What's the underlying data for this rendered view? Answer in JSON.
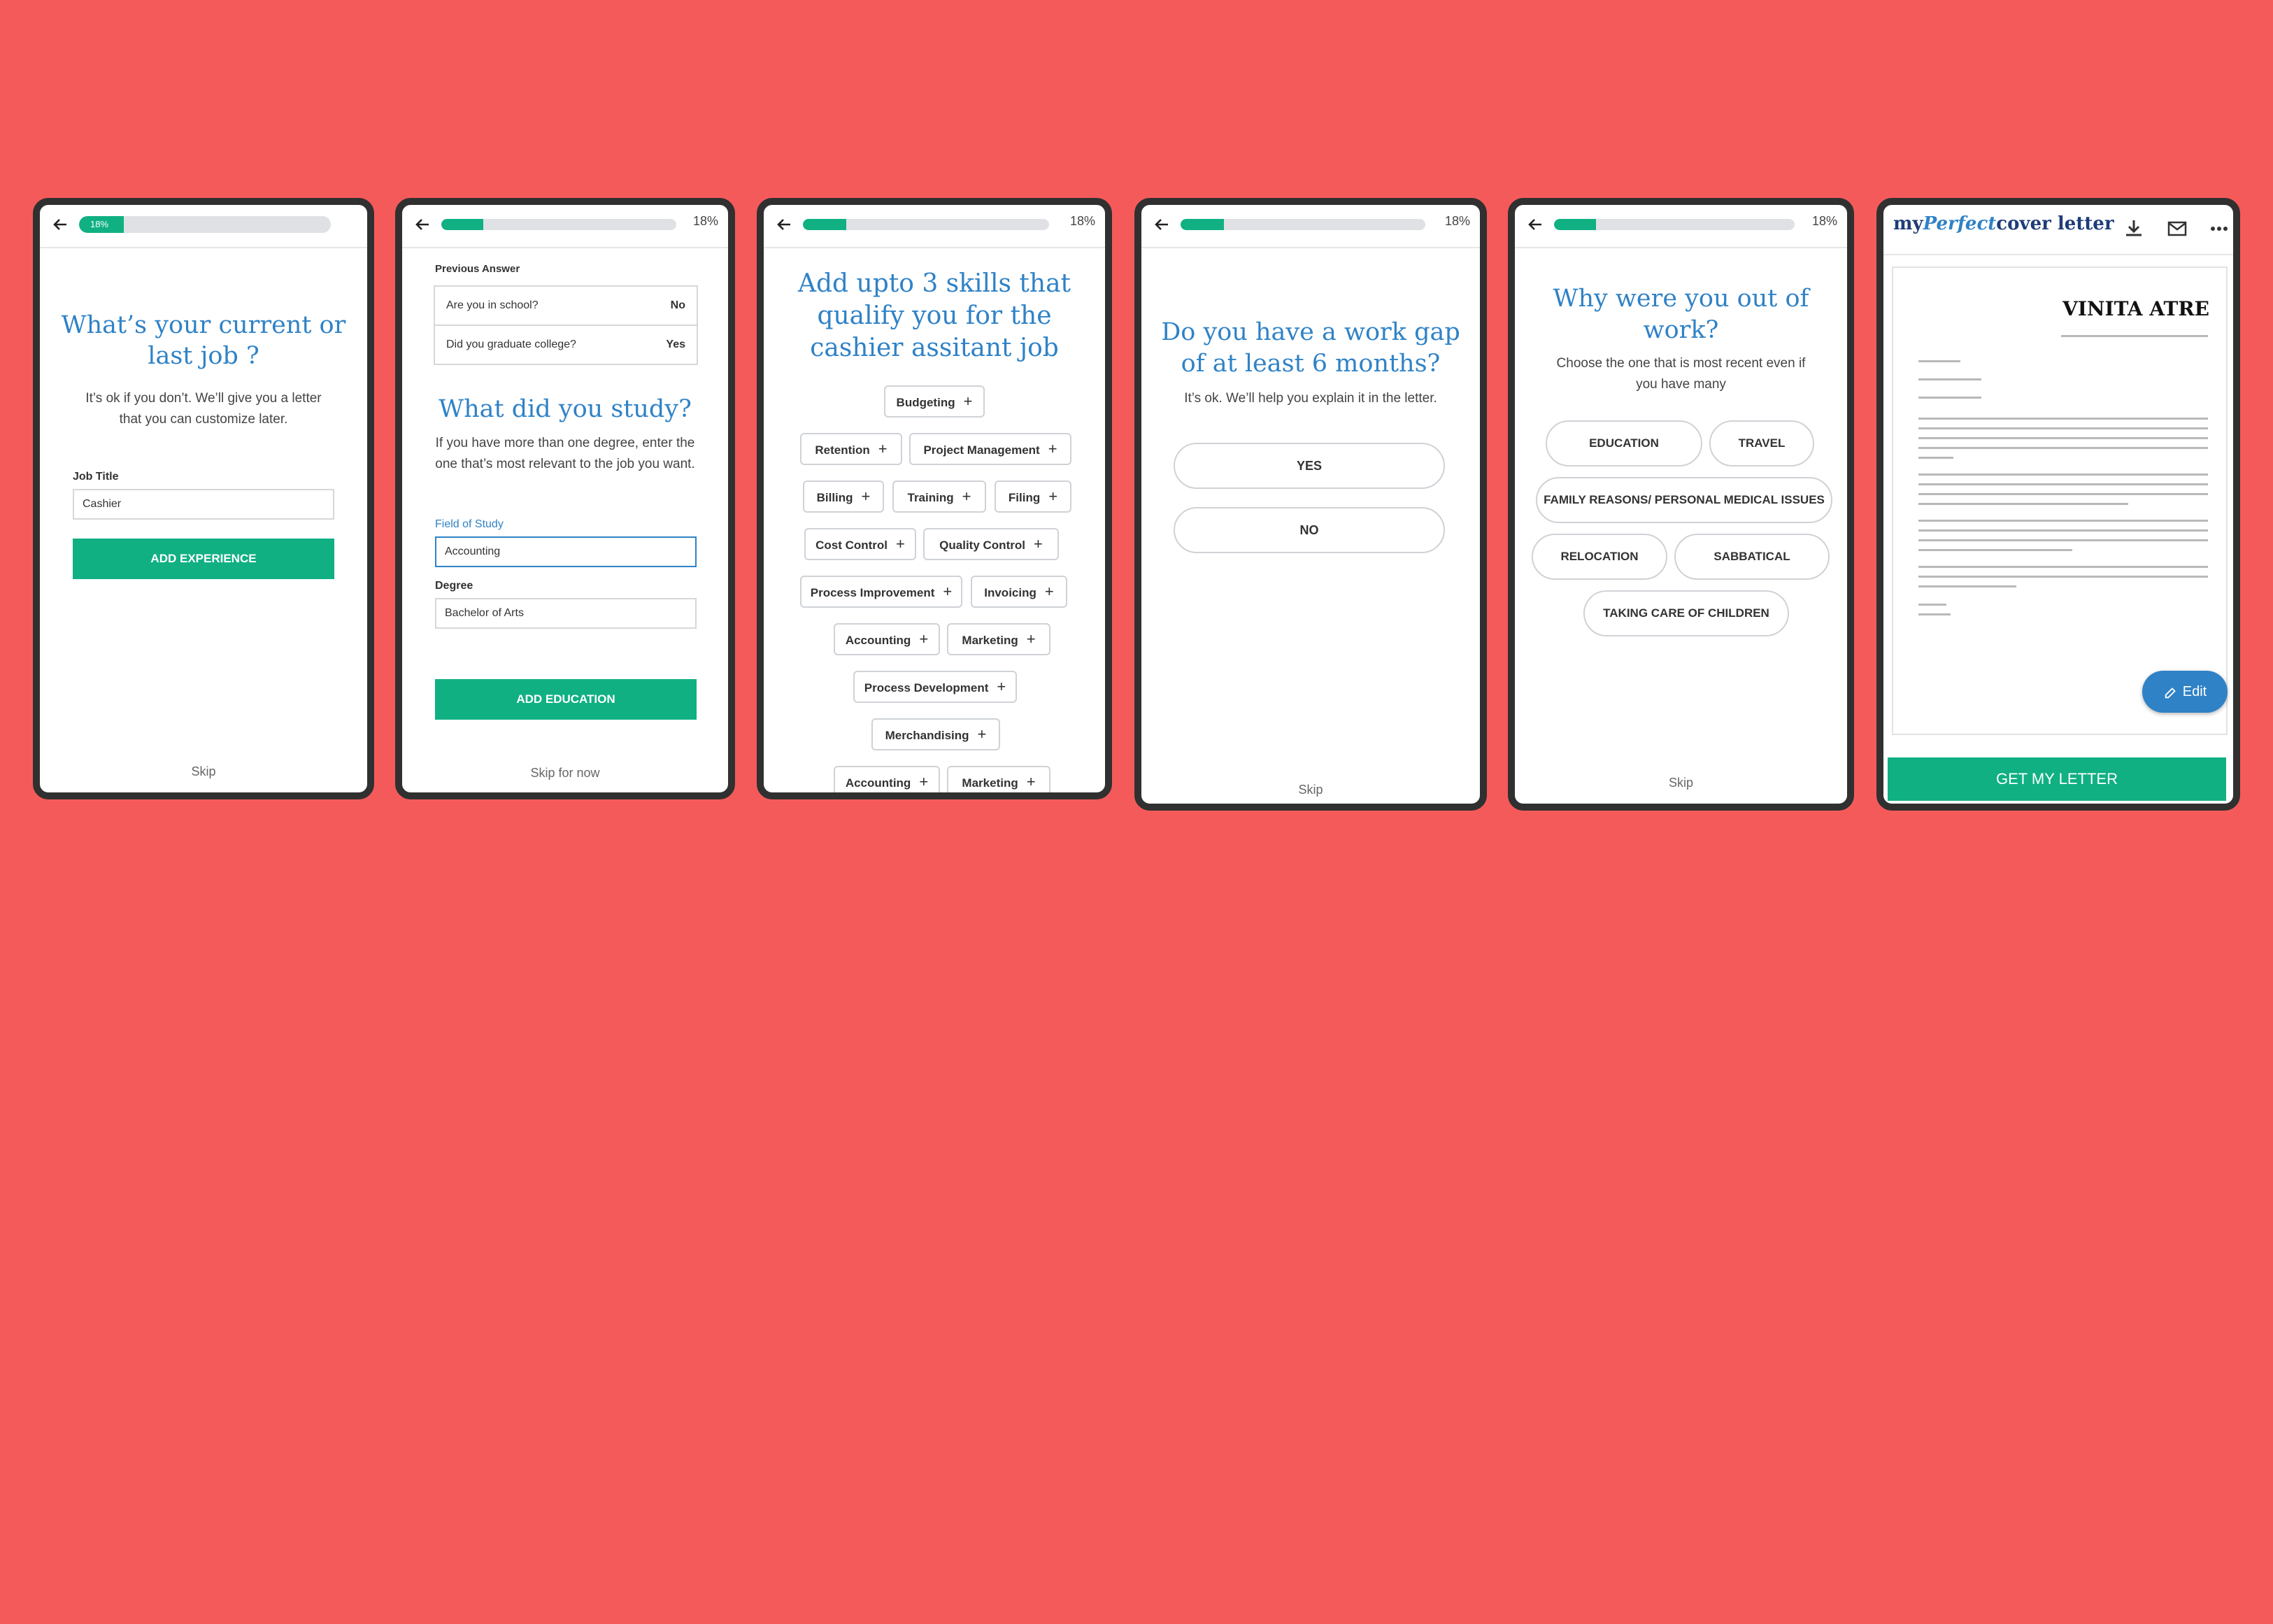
{
  "colors": {
    "background": "#f55a5a",
    "accent": "#10b083",
    "title_blue": "#2f82c6",
    "frame": "#303030"
  },
  "screen1": {
    "progress": 0.18,
    "progress_label": "18%",
    "title_line1": "What’s your current or",
    "title_line2": "last job ?",
    "subtitle_line1": "It’s ok if you don’t. We’ll give you a letter",
    "subtitle_line2": "that you can customize later.",
    "job_title_label": "Job Title",
    "job_title_value": "Cashier",
    "button": "ADD EXPERIENCE",
    "skip": "Skip"
  },
  "screen2": {
    "progress": 0.18,
    "progress_label": "18%",
    "previous_answer_label": "Previous Answer",
    "previous_answers": [
      {
        "question": "Are you in school?",
        "answer": "No"
      },
      {
        "question": "Did you graduate college?",
        "answer": "Yes"
      }
    ],
    "title": "What did you study?",
    "subtitle_line1": "If you have more than one degree, enter the",
    "subtitle_line2": "one that’s most relevant to the job you want.",
    "field_label": "Field of Study",
    "field_value": "Accounting",
    "degree_label": "Degree",
    "degree_value": "Bachelor of Arts",
    "button": "ADD EDUCATION",
    "skip": "Skip for now"
  },
  "screen3": {
    "progress": 0.18,
    "progress_label": "18%",
    "title_line1": "Add upto 3 skills that",
    "title_line2": "qualify you for the",
    "title_line3": "cashier assitant job",
    "skills": [
      "Budgeting",
      "Retention",
      "Project Management",
      "Billing",
      "Training",
      "Filing",
      "Cost Control",
      "Quality Control",
      "Process Improvement",
      "Invoicing",
      "Accounting",
      "Marketing",
      "Process Development",
      "Merchandising",
      "Accounting",
      "Marketing"
    ],
    "plus": "+"
  },
  "screen4": {
    "progress": 0.18,
    "progress_label": "18%",
    "title_line1": "Do you have a work gap",
    "title_line2": "of at least 6 months?",
    "subtitle": "It’s ok. We’ll help you explain it in the letter.",
    "options": [
      "YES",
      "NO"
    ],
    "skip": "Skip"
  },
  "screen5": {
    "progress": 0.18,
    "progress_label": "18%",
    "title_line1": "Why were you out of",
    "title_line2": "work?",
    "subtitle_line1": "Choose the one that is most recent even if",
    "subtitle_line2": "you have many",
    "options": [
      "EDUCATION",
      "TRAVEL",
      "FAMILY REASONS/ PERSONAL MEDICAL ISSUES",
      "RELOCATION",
      "SABBATICAL",
      "TAKING CARE OF CHILDREN"
    ],
    "skip": "Skip"
  },
  "screen6": {
    "logo_my": "my",
    "logo_perfect": "Perfect",
    "logo_rest": "cover letter",
    "icons": [
      "download-icon",
      "mail-icon",
      "more-icon"
    ],
    "letter_name": "VINITA ATRE",
    "edit": "Edit",
    "button": "GET MY LETTER"
  }
}
